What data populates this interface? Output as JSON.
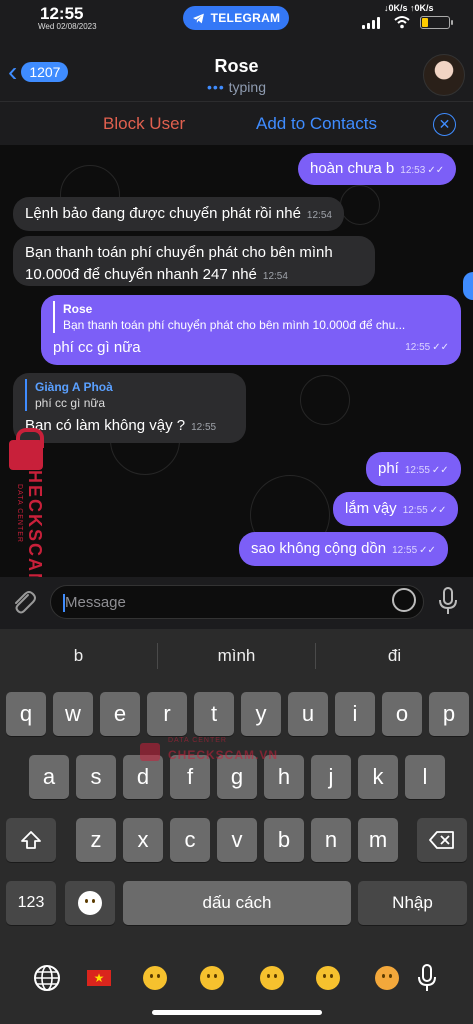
{
  "status": {
    "time": "12:55",
    "date": "Wed 02/08/2023",
    "pill": "TELEGRAM",
    "down": "↓0K/s",
    "up": "↑0K/s"
  },
  "header": {
    "back_count": "1207",
    "name": "Rose",
    "status": "typing"
  },
  "actions": {
    "block": "Block User",
    "add": "Add to Contacts"
  },
  "messages": [
    {
      "dir": "out",
      "text": "hoàn chưa b",
      "time": "12:53"
    },
    {
      "dir": "in",
      "text": "Lệnh bảo đang được chuyển phát rồi nhé",
      "time": "12:54"
    },
    {
      "dir": "in",
      "text": "Bạn thanh toán phí chuyển phát cho bên mình 10.000đ để chuyển nhanh 247 nhé",
      "time": "12:54"
    },
    {
      "dir": "out",
      "reply_name": "Rose",
      "reply_text": "Bạn thanh toán phí chuyển phát cho bên mình 10.000đ để chu...",
      "text": "phí cc gì nữa",
      "time": "12:55"
    },
    {
      "dir": "in",
      "reply_name": "Giàng A Phoà",
      "reply_text": "phí cc gì nữa",
      "text": "Bạn có làm không vậy ?",
      "time": "12:55"
    },
    {
      "dir": "out",
      "text": "phí",
      "time": "12:55"
    },
    {
      "dir": "out",
      "text": "lắm vậy",
      "time": "12:55"
    },
    {
      "dir": "out",
      "text": "sao không cộng dồn",
      "time": "12:55"
    }
  ],
  "watermark": {
    "big": "CHECKSCAM.VN",
    "small": "DATA CENTER"
  },
  "input": {
    "placeholder": "Message"
  },
  "suggestions": [
    "b",
    "mình",
    "đi"
  ],
  "keys": {
    "row1": [
      "q",
      "w",
      "e",
      "r",
      "t",
      "y",
      "u",
      "i",
      "o",
      "p"
    ],
    "row2": [
      "a",
      "s",
      "d",
      "f",
      "g",
      "h",
      "j",
      "k",
      "l"
    ],
    "row3": [
      "z",
      "x",
      "c",
      "v",
      "b",
      "n",
      "m"
    ],
    "num": "123",
    "space": "dấu cách",
    "enter": "Nhập"
  },
  "icons": [
    "telegram-icon",
    "back-chevron-icon",
    "close-icon",
    "attach-icon",
    "sticker-icon",
    "mic-icon",
    "shift-icon",
    "delete-icon",
    "emoji-icon",
    "globe-icon",
    "flag-vn-icon"
  ],
  "colors": {
    "accent": "#3f8cff",
    "outgoing": "#7c5ff7",
    "block": "#e1604f",
    "watermark": "#c8203a"
  }
}
